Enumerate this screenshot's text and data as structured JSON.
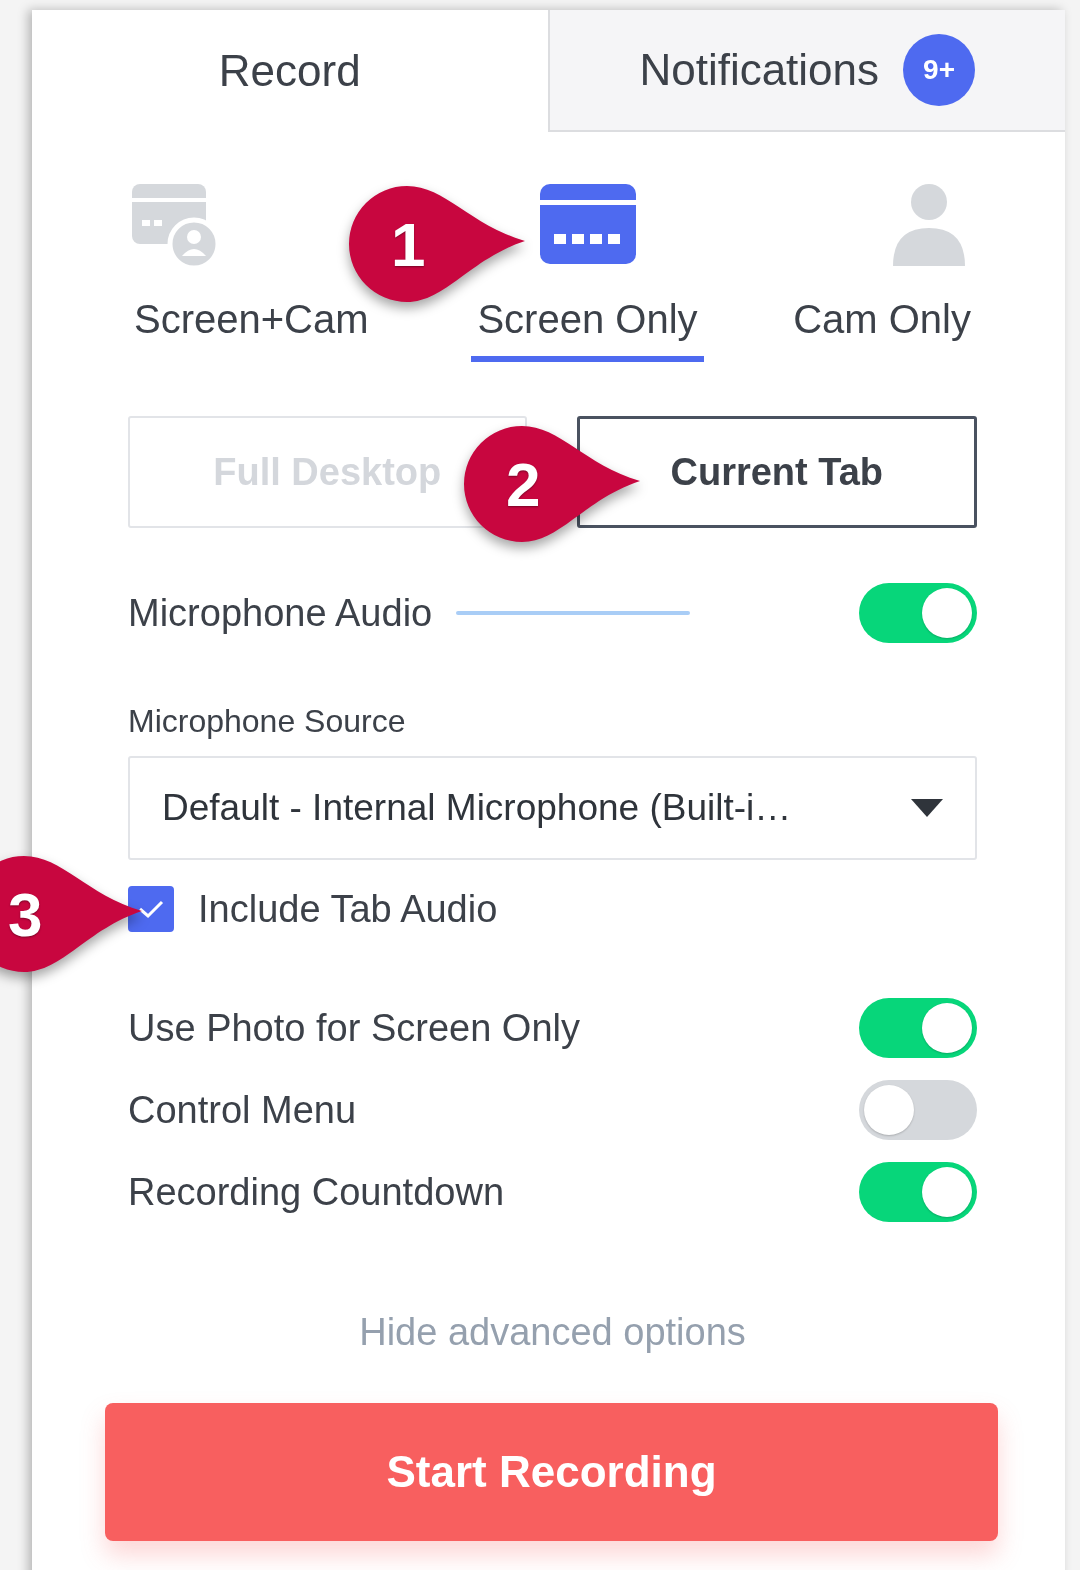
{
  "tabs": [
    {
      "label": "Record",
      "selected": true
    },
    {
      "label": "Notifications",
      "selected": false,
      "badge": "9+"
    }
  ],
  "modes": [
    {
      "label": "Screen+Cam",
      "kind": "screen-cam",
      "selected": false
    },
    {
      "label": "Screen Only",
      "kind": "screen",
      "selected": true
    },
    {
      "label": "Cam Only",
      "kind": "cam",
      "selected": false
    }
  ],
  "capture": [
    {
      "label": "Full Desktop",
      "selected": false
    },
    {
      "label": "Current Tab",
      "selected": true
    }
  ],
  "microphone_audio": {
    "label": "Microphone Audio",
    "on": true
  },
  "microphone_source": {
    "label": "Microphone Source",
    "value": "Default - Internal Microphone (Built-i…"
  },
  "include_tab_audio": {
    "label": "Include Tab Audio",
    "checked": true
  },
  "toggles": [
    {
      "label": "Use Photo for Screen Only",
      "on": true
    },
    {
      "label": "Control Menu",
      "on": false
    },
    {
      "label": "Recording Countdown",
      "on": true
    }
  ],
  "hide_link": "Hide advanced options",
  "start_button": "Start Recording",
  "callouts": [
    {
      "number": "1"
    },
    {
      "number": "2"
    },
    {
      "number": "3"
    }
  ]
}
